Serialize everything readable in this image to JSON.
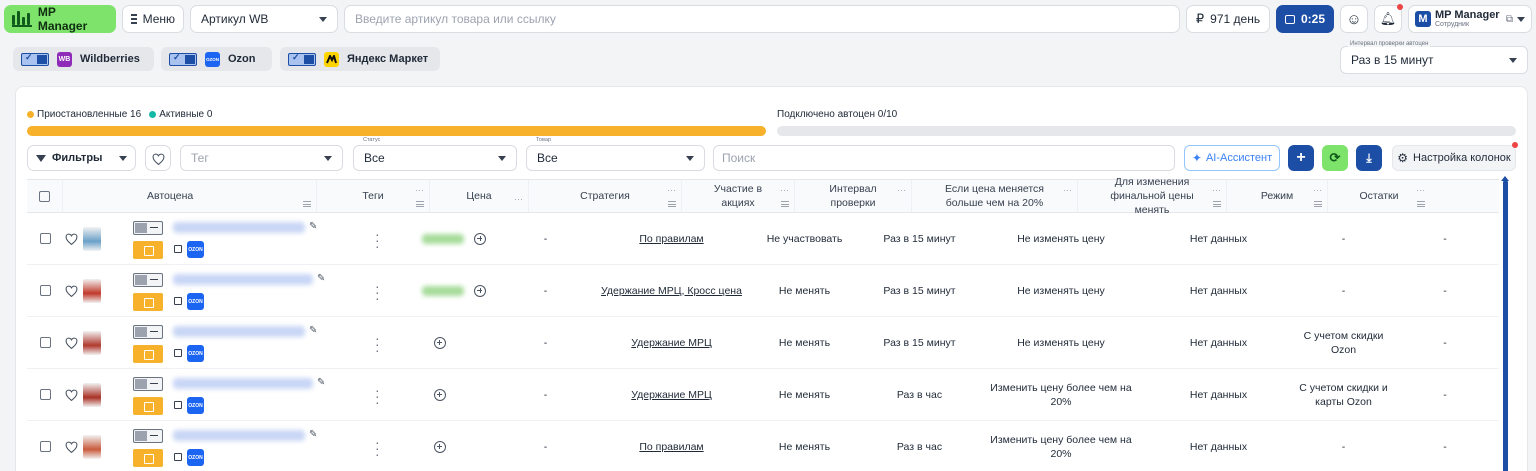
{
  "header": {
    "brand": "MP Manager",
    "menu_label": "Меню",
    "article_select": "Артикул WB",
    "search_placeholder": "Введите артикул товара или ссылку",
    "balance": "971 день",
    "timer": "0:25",
    "user_name": "MP Manager",
    "user_role": "Сотрудник",
    "user_initial": "M",
    "currency_symbol": "₽"
  },
  "marketplaces": [
    {
      "name": "Wildberries",
      "logo_text": "WB",
      "logo_color": "#8e2bb8",
      "enabled": true
    },
    {
      "name": "Ozon",
      "logo_text": "OZON",
      "logo_color": "#1c64f2",
      "enabled": true
    },
    {
      "name": "Яндекс Маркет",
      "logo_text": "",
      "logo_color": "#ffd400",
      "enabled": true
    }
  ],
  "interval": {
    "label": "Интервал проверки автоцен",
    "value": "Раз в 15 минут"
  },
  "stats": {
    "paused": "Приостановленные 16",
    "active": "Активные 0",
    "connected": "Подключено автоцен 0/10",
    "paused_color": "#f7b12a",
    "active_color": "#14b8a6"
  },
  "filters": {
    "filters_label": "Фильтры",
    "tag_placeholder": "Тег",
    "status_label": "Статус",
    "status_value": "Все",
    "product_label": "Товар",
    "product_value": "Все",
    "search_placeholder": "Поиск",
    "ai_label": "AI-Ассистент",
    "columns_label": "Настройка колонок"
  },
  "columns": [
    "Автоцена",
    "Теги",
    "Цена",
    "Стратегия",
    "Участие в акциях",
    "Интервал проверки",
    "Если цена меняется больше чем на 20%",
    "Для изменения финальной цены менять",
    "Режим",
    "Остатки"
  ],
  "rows": [
    {
      "price": "-",
      "strategy": "По правилам",
      "promo": "Не участвовать",
      "interval": "Раз в 15 минут",
      "change20": "Не изменять цену",
      "final": "Нет данных",
      "mode": "-",
      "stock": "-",
      "has_tag": true,
      "thumb_color": "#6aa0c8"
    },
    {
      "price": "-",
      "strategy": "Удержание МРЦ, Кросс цена",
      "promo": "Не менять",
      "interval": "Раз в 15 минут",
      "change20": "Не изменять цену",
      "final": "Нет данных",
      "mode": "-",
      "stock": "-",
      "has_tag": true,
      "thumb_color": "#c0392b"
    },
    {
      "price": "-",
      "strategy": "Удержание МРЦ",
      "promo": "Не менять",
      "interval": "Раз в 15 минут",
      "change20": "Не изменять цену",
      "final": "Нет данных",
      "mode": "С учетом скидки Ozon",
      "stock": "-",
      "has_tag": false,
      "thumb_color": "#b03a2e"
    },
    {
      "price": "-",
      "strategy": "Удержание МРЦ",
      "promo": "Не менять",
      "interval": "Раз в час",
      "change20": "Изменить цену более чем на 20%",
      "final": "Нет данных",
      "mode": "С учетом скидки и карты Ozon",
      "stock": "-",
      "has_tag": false,
      "thumb_color": "#a93226"
    },
    {
      "price": "-",
      "strategy": "По правилам",
      "promo": "Не менять",
      "interval": "Раз в час",
      "change20": "Изменить цену более чем на 20%",
      "final": "Нет данных",
      "mode": "-",
      "stock": "-",
      "has_tag": false,
      "thumb_color": "#c85a3c"
    }
  ]
}
